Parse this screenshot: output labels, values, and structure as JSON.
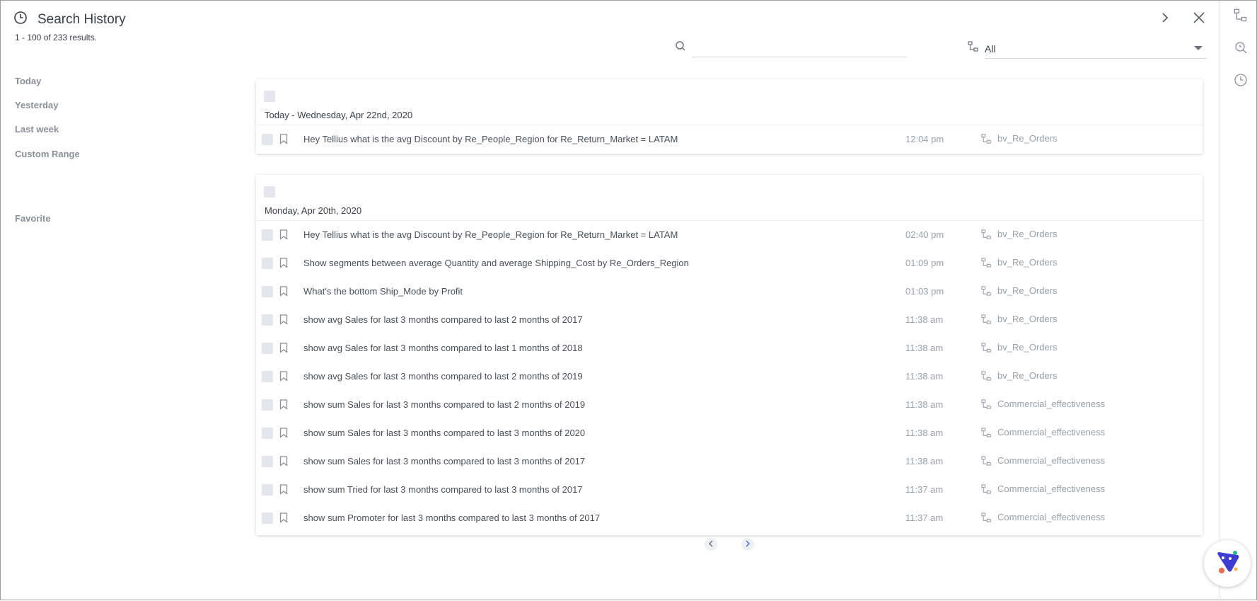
{
  "header": {
    "title": "Search History",
    "results": "1 - 100 of 233 results."
  },
  "search": {
    "value": "",
    "placeholder": ""
  },
  "filter": {
    "selected": "All"
  },
  "nav": {
    "today": "Today",
    "yesterday": "Yesterday",
    "last_week": "Last week",
    "custom_range": "Custom Range",
    "favorite": "Favorite"
  },
  "groups": [
    {
      "title": "Today - Wednesday, Apr 22nd, 2020",
      "rows": [
        {
          "query": "Hey Tellius what is the avg Discount by Re_People_Region for Re_Return_Market = LATAM",
          "time": "12:04 pm",
          "datasource": "bv_Re_Orders"
        }
      ]
    },
    {
      "title": "Monday, Apr 20th, 2020",
      "rows": [
        {
          "query": "Hey Tellius what is the avg Discount by Re_People_Region for Re_Return_Market = LATAM",
          "time": "02:40 pm",
          "datasource": "bv_Re_Orders"
        },
        {
          "query": "Show segments between average Quantity and average Shipping_Cost by Re_Orders_Region",
          "time": "01:09 pm",
          "datasource": "bv_Re_Orders"
        },
        {
          "query": "What's the bottom Ship_Mode by Profit",
          "time": "01:03 pm",
          "datasource": "bv_Re_Orders"
        },
        {
          "query": "show avg Sales for last 3 months compared to last 2 months of 2017",
          "time": "11:38 am",
          "datasource": "bv_Re_Orders"
        },
        {
          "query": "show avg Sales for last 3 months compared to last 1 months of 2018",
          "time": "11:38 am",
          "datasource": "bv_Re_Orders"
        },
        {
          "query": "show avg Sales for last 3 months compared to last 2 months of 2019",
          "time": "11:38 am",
          "datasource": "bv_Re_Orders"
        },
        {
          "query": "show sum Sales for last 3 months compared to last 2 months of 2019",
          "time": "11:38 am",
          "datasource": "Commercial_effectiveness"
        },
        {
          "query": "show sum Sales for last 3 months compared to last 3 months of 2020",
          "time": "11:38 am",
          "datasource": "Commercial_effectiveness"
        },
        {
          "query": "show sum Sales for last 3 months compared to last 3 months of 2017",
          "time": "11:38 am",
          "datasource": "Commercial_effectiveness"
        },
        {
          "query": "show sum Tried for last 3 months compared to last 3 months of 2017",
          "time": "11:37 am",
          "datasource": "Commercial_effectiveness"
        },
        {
          "query": "show sum Promoter for last 3 months compared to last 3 months of 2017",
          "time": "11:37 am",
          "datasource": "Commercial_effectiveness"
        }
      ]
    }
  ],
  "icons": {
    "title": "history-icon",
    "next": "chevron-right-icon",
    "close": "close-icon",
    "search": "search-icon",
    "datasource": "datasource-icon",
    "bookmark": "bookmark-icon",
    "rail_1": "datasource-icon",
    "rail_2": "search-history-icon",
    "rail_3": "clock-icon",
    "pager_prev": "chevron-left-icon",
    "pager_next": "chevron-right-icon",
    "chat": "chat-widget-icon"
  },
  "colors": {
    "accent": "#4a6cf7",
    "chat_brand": "#3d3dd6",
    "text": "#4a4f57",
    "muted": "#9aa0a8"
  }
}
